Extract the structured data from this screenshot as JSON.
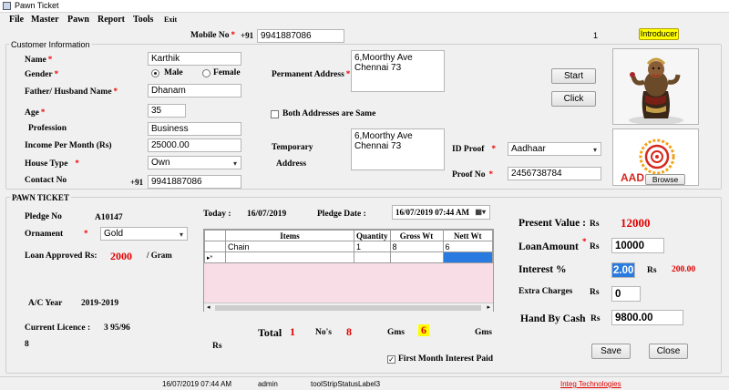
{
  "window": {
    "title": "Pawn Ticket"
  },
  "menu": [
    "File",
    "Master",
    "Pawn",
    "Report",
    "Tools",
    "Exit"
  ],
  "header": {
    "mobile_label": "Mobile No",
    "country_code": "+91",
    "mobile_value": "9941887086",
    "counter": "1",
    "introducer_button": "Introducer"
  },
  "customer": {
    "group_title": "Customer Information",
    "name_label": "Name",
    "name_value": "Karthik",
    "gender_label": "Gender",
    "gender_options": [
      "Male",
      "Female"
    ],
    "gender_selected": "Male",
    "father_label": "Father/ Husband Name",
    "father_value": "Dhanam",
    "age_label": "Age",
    "age_value": "35",
    "profession_label": "Profession",
    "profession_value": "Business",
    "income_label": "Income Per Month  (Rs)",
    "income_value": "25000.00",
    "house_label": "House Type",
    "house_value": "Own",
    "contact_label": "Contact No",
    "contact_code": "+91",
    "contact_value": "9941887086",
    "permanent_label": "Permanent Address",
    "permanent_line1": "6,Moorthy Ave",
    "permanent_line2": "Chennai 73",
    "both_label": "Both Addresses are Same",
    "temporary_label1": "Temporary",
    "temporary_label2": "Address",
    "temporary_line1": "6,Moorthy Ave",
    "temporary_line2": "Chennai 73",
    "start_button": "Start",
    "click_button": "Click",
    "idproof_label": "ID Proof",
    "idproof_value": "Aadhaar",
    "proofno_label": "Proof No",
    "proofno_value": "2456738784",
    "browse_button": "Browse",
    "aadhaar_text": "AAD"
  },
  "pawn": {
    "group_title": "PAWN TICKET",
    "pledge_no_label": "Pledge No",
    "pledge_no_value": "A10147",
    "ornament_label": "Ornament",
    "ornament_value": "Gold",
    "loan_approved_label": "Loan Approved Rs:",
    "loan_approved_value": "2000",
    "per_gram": "/ Gram",
    "ac_year_label": "A/C Year",
    "ac_year_value": "2019-2019",
    "licence_label": "Current Licence :",
    "licence_value": "3 95/96",
    "licence_value2": "8",
    "rs_label": "Rs",
    "today_label": "Today :",
    "today_value": "16/07/2019",
    "pledge_date_label": "Pledge Date :",
    "pledge_date_value": "16/07/2019 07:44 AM",
    "grid_columns": [
      "Items",
      "Quantity",
      "Gross Wt",
      "Nett Wt"
    ],
    "grid_rows": [
      [
        "Chain",
        "1",
        "8",
        "6"
      ]
    ],
    "total_label": "Total",
    "total_value": "1",
    "nos_label": "No's",
    "nos_value": "8",
    "gms_label": "Gms",
    "gms_value": "6",
    "gms_label2": "Gms",
    "first_month_label": "First Month Interest Paid"
  },
  "summary": {
    "present_value_label": "Present Value :",
    "present_value_rs": "Rs",
    "present_value": "12000",
    "loan_amount_label": "LoanAmount",
    "loan_amount_rs": "Rs",
    "loan_amount_value": "10000",
    "interest_label": "Interest %",
    "interest_value": "2.00",
    "interest_rs": "Rs",
    "interest_amount": "200.00",
    "extra_label": "Extra Charges",
    "extra_rs": "Rs",
    "extra_value": "0",
    "hand_label": "Hand By Cash",
    "hand_rs": "Rs",
    "hand_value": "9800.00",
    "save_button": "Save",
    "close_button": "Close"
  },
  "status": {
    "datetime": "16/07/2019 07:44 AM",
    "user": "admin",
    "label3": "toolStripStatusLabel3",
    "company": "Integ Technologies"
  },
  "colors": {
    "required": "#e00000",
    "introducer_bg": "#ffff00",
    "link": "#e00000",
    "highlight": "#2a7be0"
  }
}
